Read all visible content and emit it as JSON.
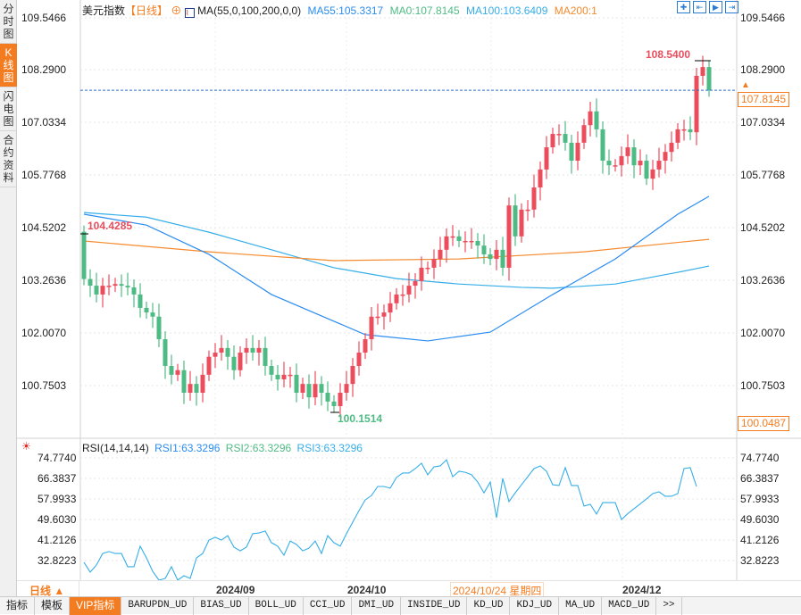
{
  "sidebar": {
    "tabs": [
      {
        "label": "分时图"
      },
      {
        "label": "K线图",
        "active": true
      },
      {
        "label": "闪电图"
      },
      {
        "label": "合约资料"
      }
    ]
  },
  "header": {
    "name": "美元指数",
    "period": "【日线】",
    "ma_label": "MA(55,0,100,200,0,0)",
    "ma55": "MA55:105.3317",
    "ma0": "MA0:107.8145",
    "ma100": "MA100:103.6409",
    "ma200": "MA200:1"
  },
  "rsi_header": {
    "label": "RSI(14,14,14)",
    "rsi1": "RSI1:63.3296",
    "rsi2": "RSI2:63.3296",
    "rsi3": "RSI3:63.3296"
  },
  "price_axis": {
    "ticks": [
      "109.5466",
      "108.2900",
      "107.0334",
      "105.7768",
      "104.5202",
      "103.2636",
      "102.0070",
      "100.7503"
    ],
    "current": "107.8145",
    "low_box": "100.0487"
  },
  "rsi_axis": {
    "ticks": [
      "74.7740",
      "66.3837",
      "57.9933",
      "49.6030",
      "41.2126",
      "32.8223"
    ]
  },
  "markers": {
    "high": "108.5400",
    "start": "104.4285",
    "low": "100.1514"
  },
  "dates": {
    "d1": "2024/09",
    "d2": "2024/10",
    "cursor": "2024/10/24 星期四",
    "d3": "2024/12"
  },
  "period_label": "日线 ▲",
  "toolbar": [
    "指标",
    "模板",
    "VIP指标",
    "BARUPDN_UD",
    "BIAS_UD",
    "BOLL_UD",
    "CCI_UD",
    "DMI_UD",
    "INSIDE_UD",
    "KD_UD",
    "KDJ_UD",
    "MA_UD",
    "MACD_UD",
    ">>"
  ],
  "colors": {
    "up": "#ec4d5d",
    "down": "#4fbb84",
    "ma55": "#2a8cf0",
    "ma100": "#35aee8",
    "ma200": "#f58a2e",
    "accent": "#f47c20",
    "rsi": "#35aee8"
  },
  "chart_data": {
    "type": "candlestick",
    "ylim": [
      99.9,
      109.6
    ],
    "open_first": 104.43,
    "closes": [
      103.3,
      103.14,
      102.93,
      103.14,
      103.14,
      103.18,
      103.14,
      103.1,
      102.93,
      102.61,
      102.5,
      102.4,
      101.86,
      101.22,
      101.01,
      101.12,
      100.58,
      100.79,
      100.58,
      101.01,
      101.44,
      101.54,
      101.65,
      101.44,
      101.12,
      101.54,
      101.65,
      101.54,
      101.65,
      101.22,
      101.01,
      100.9,
      101.01,
      101.01,
      100.58,
      100.79,
      100.47,
      100.79,
      100.58,
      100.37,
      100.26,
      100.58,
      100.79,
      101.22,
      101.54,
      101.86,
      102.4,
      102.4,
      102.5,
      102.72,
      102.93,
      102.93,
      103.14,
      103.25,
      103.57,
      103.57,
      103.78,
      104.0,
      104.32,
      104.32,
      104.21,
      104.21,
      104.21,
      104.1,
      103.89,
      103.78,
      104.0,
      103.57,
      105.06,
      104.32,
      104.96,
      104.96,
      105.49,
      105.92,
      106.45,
      106.77,
      106.77,
      106.56,
      106.13,
      106.56,
      106.98,
      107.31,
      106.88,
      106.13,
      106.02,
      106.02,
      106.24,
      106.45,
      106.02,
      106.13,
      105.7,
      105.92,
      106.13,
      106.34,
      106.56,
      106.88,
      106.88,
      106.81,
      108.16,
      108.37,
      107.81
    ],
    "ma55": [
      [
        0,
        104.85
      ],
      [
        10,
        104.59
      ],
      [
        20,
        103.89
      ],
      [
        30,
        102.93
      ],
      [
        40,
        102.29
      ],
      [
        45,
        101.97
      ],
      [
        55,
        101.82
      ],
      [
        65,
        102.03
      ],
      [
        75,
        102.93
      ],
      [
        85,
        103.78
      ],
      [
        95,
        104.85
      ],
      [
        100,
        105.28
      ]
    ],
    "ma100": [
      [
        0,
        104.89
      ],
      [
        10,
        104.78
      ],
      [
        20,
        104.42
      ],
      [
        30,
        104.0
      ],
      [
        40,
        103.57
      ],
      [
        50,
        103.31
      ],
      [
        60,
        103.18
      ],
      [
        70,
        103.1
      ],
      [
        75,
        103.08
      ],
      [
        85,
        103.18
      ],
      [
        95,
        103.46
      ],
      [
        100,
        103.61
      ]
    ],
    "ma200": [
      [
        0,
        104.21
      ],
      [
        20,
        103.95
      ],
      [
        40,
        103.74
      ],
      [
        60,
        103.78
      ],
      [
        80,
        103.95
      ],
      [
        100,
        104.25
      ]
    ],
    "rsi": {
      "ylim": [
        22,
        78
      ],
      "values": [
        32.1,
        28.1,
        31.0,
        35.7,
        36.5,
        35.7,
        35.7,
        30.3,
        30.3,
        38.7,
        33.9,
        28.4,
        24.8,
        25.5,
        30.3,
        24.8,
        26.6,
        25.5,
        33.9,
        35.7,
        41.2,
        42.3,
        41.2,
        43.0,
        38.3,
        36.8,
        38.3,
        43.8,
        44.1,
        44.9,
        40.1,
        38.7,
        35.0,
        40.8,
        39.4,
        36.8,
        37.9,
        40.8,
        35.7,
        43.0,
        40.1,
        38.7,
        43.8,
        48.5,
        53.2,
        57.6,
        59.4,
        63.1,
        63.1,
        62.4,
        66.8,
        68.6,
        68.6,
        70.4,
        72.6,
        67.9,
        71.1,
        71.5,
        74.0,
        67.1,
        69.3,
        68.9,
        67.9,
        64.9,
        60.5,
        64.9,
        50.3,
        66.4,
        56.9,
        60.5,
        63.8,
        67.1,
        70.4,
        71.5,
        69.3,
        63.8,
        63.5,
        70.8,
        63.5,
        63.5,
        55.1,
        55.8,
        51.8,
        56.5,
        56.5,
        56.5,
        49.6,
        52.0,
        54.0,
        56.0,
        58.0,
        60.2,
        60.9,
        59.1,
        59.1,
        60.2,
        70.4,
        70.8,
        63.1
      ]
    }
  }
}
